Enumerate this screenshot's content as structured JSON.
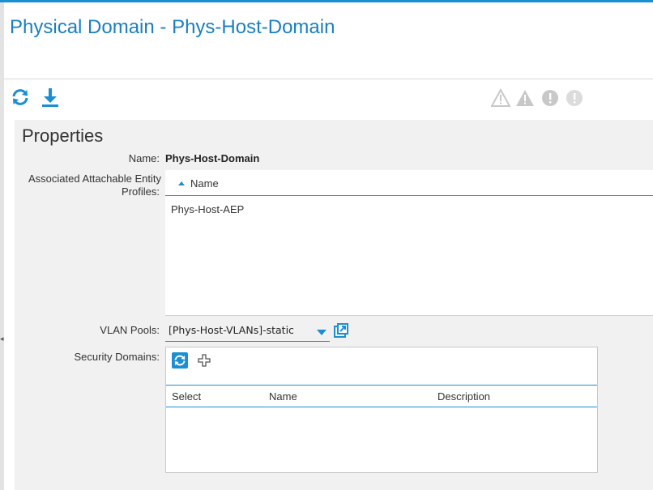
{
  "header": {
    "title": "Physical Domain - Phys-Host-Domain"
  },
  "toolbar": {
    "refresh_icon": "refresh-icon",
    "download_icon": "download-icon",
    "fault_icons": [
      "critical-fault-icon",
      "major-fault-icon",
      "minor-fault-icon",
      "warning-fault-icon"
    ]
  },
  "properties": {
    "title": "Properties",
    "name_label": "Name:",
    "name_value": "Phys-Host-Domain",
    "aep_label_line1": "Associated Attachable Entity",
    "aep_label_line2": "Profiles:",
    "aep_table": {
      "columns": [
        "Name"
      ],
      "rows": [
        "Phys-Host-AEP"
      ]
    },
    "vlan_label": "VLAN Pools:",
    "vlan_value": "[Phys-Host-VLANs]-static",
    "security_label": "Security Domains:",
    "security_table": {
      "columns": [
        "Select",
        "Name",
        "Description"
      ],
      "rows": []
    }
  },
  "colors": {
    "accent": "#1b8fd1",
    "title": "#1a7fc1",
    "panel_bg": "#f1f1f1"
  }
}
